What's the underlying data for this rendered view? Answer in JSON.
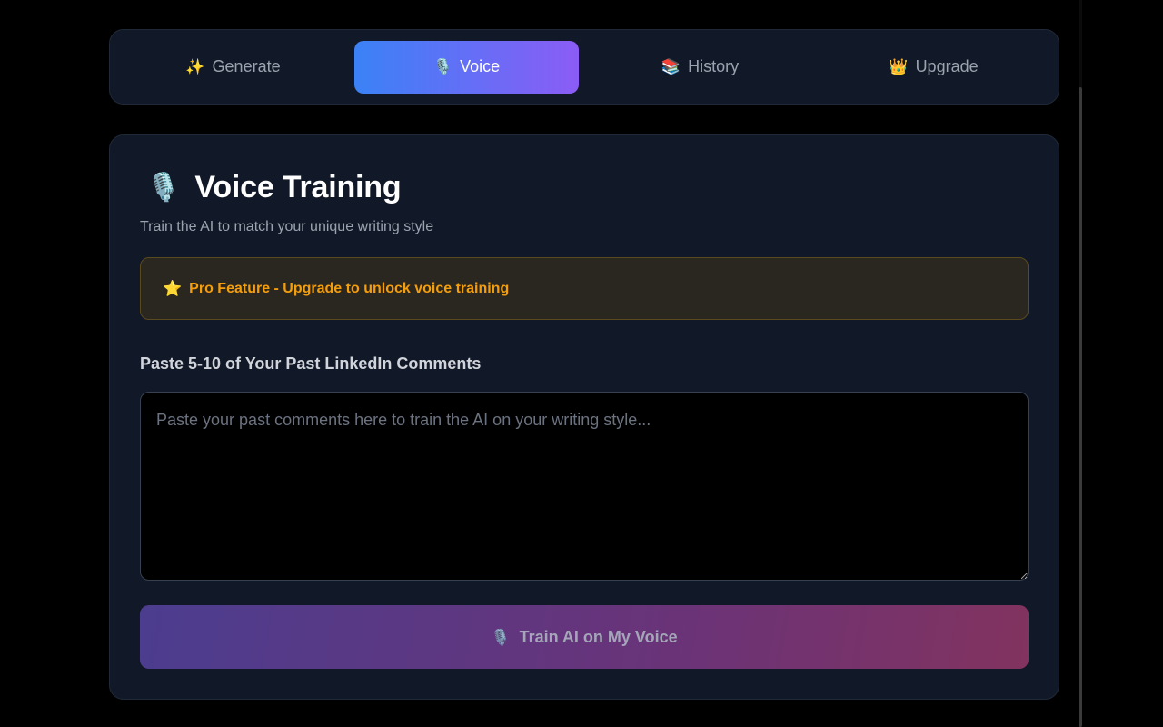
{
  "tabs": [
    {
      "icon": "✨",
      "icon_name": "sparkles-icon",
      "label": "Generate",
      "active": false
    },
    {
      "icon": "🎙️",
      "icon_name": "microphone-icon",
      "label": "Voice",
      "active": true
    },
    {
      "icon": "📚",
      "icon_name": "books-icon",
      "label": "History",
      "active": false
    },
    {
      "icon": "👑",
      "icon_name": "crown-icon",
      "label": "Upgrade",
      "active": false
    }
  ],
  "voice_training": {
    "title_icon": "🎙️",
    "title": "Voice Training",
    "subtitle": "Train the AI to match your unique writing style",
    "pro_banner": {
      "icon": "⭐",
      "text": "Pro Feature - Upgrade to unlock voice training"
    },
    "comments_field": {
      "label": "Paste 5-10 of Your Past LinkedIn Comments",
      "value": "",
      "placeholder": "Paste your past comments here to train the AI on your writing style..."
    },
    "train_button": {
      "icon": "🎙️",
      "label": "Train AI on My Voice"
    }
  },
  "colors": {
    "background": "#000000",
    "card": "#111827",
    "accent_start": "#3b82f6",
    "accent_end": "#8b5cf6",
    "pro_text": "#f59e0b"
  }
}
